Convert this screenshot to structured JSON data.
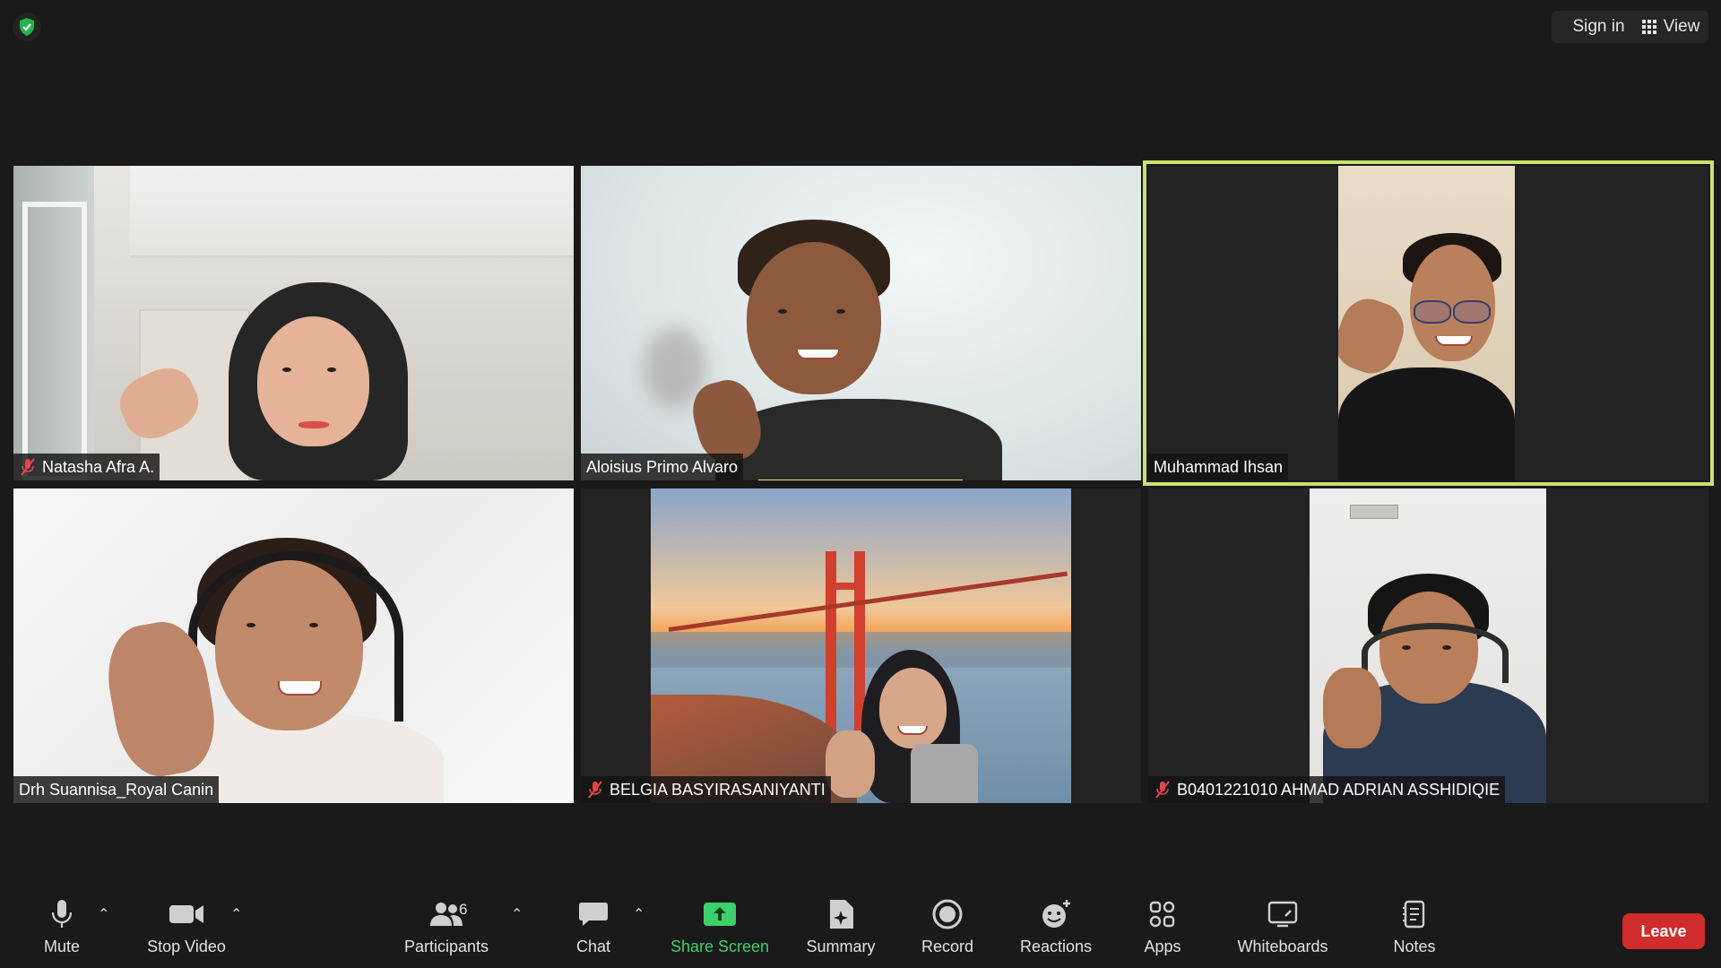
{
  "topbar": {
    "sign_in": "Sign in",
    "view": "View"
  },
  "participants": [
    {
      "name": "Natasha Afra A.",
      "muted": true
    },
    {
      "name": "Aloisius Primo Alvaro",
      "muted": false
    },
    {
      "name": "Muhammad Ihsan",
      "muted": false,
      "active_speaker": true
    },
    {
      "name": "Drh Suannisa_Royal Canin",
      "muted": false
    },
    {
      "name": "BELGIA BASYIRASANIYANTI",
      "muted": true
    },
    {
      "name": "B0401221010 AHMAD ADRIAN ASSHIDIQIE",
      "muted": true
    }
  ],
  "toolbar": {
    "mute": "Mute",
    "stop_video": "Stop Video",
    "participants": "Participants",
    "participants_count": "6",
    "chat": "Chat",
    "share_screen": "Share Screen",
    "summary": "Summary",
    "record": "Record",
    "reactions": "Reactions",
    "apps": "Apps",
    "whiteboards": "Whiteboards",
    "notes": "Notes",
    "leave": "Leave"
  },
  "colors": {
    "background": "#1a1a1a",
    "active_speaker_border": "#c9e26f",
    "share_green": "#3ed06a",
    "leave_red": "#d12c2c",
    "muted_red": "#e0474c",
    "security_green": "#24b24b"
  }
}
